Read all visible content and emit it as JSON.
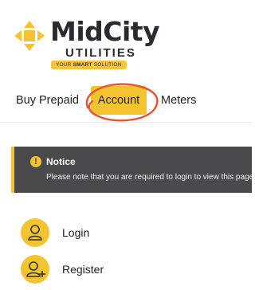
{
  "brand": {
    "name": "MidCity",
    "subtitle": "UTILITIES",
    "tagline_prefix": "YOUR ",
    "tagline_bold": "SMART",
    "tagline_suffix": " SOLUTION",
    "accent_color": "#f4c430"
  },
  "tabs": [
    {
      "label": "Buy Prepaid",
      "active": false
    },
    {
      "label": "Account",
      "active": true
    },
    {
      "label": "Meters",
      "active": false
    }
  ],
  "notice": {
    "title": "Notice",
    "text": "Please note that you are required to login to view this page.",
    "icon": "exclamation-icon"
  },
  "menu": [
    {
      "label": "Login",
      "icon": "user-icon"
    },
    {
      "label": "Register",
      "icon": "user-plus-icon"
    }
  ]
}
